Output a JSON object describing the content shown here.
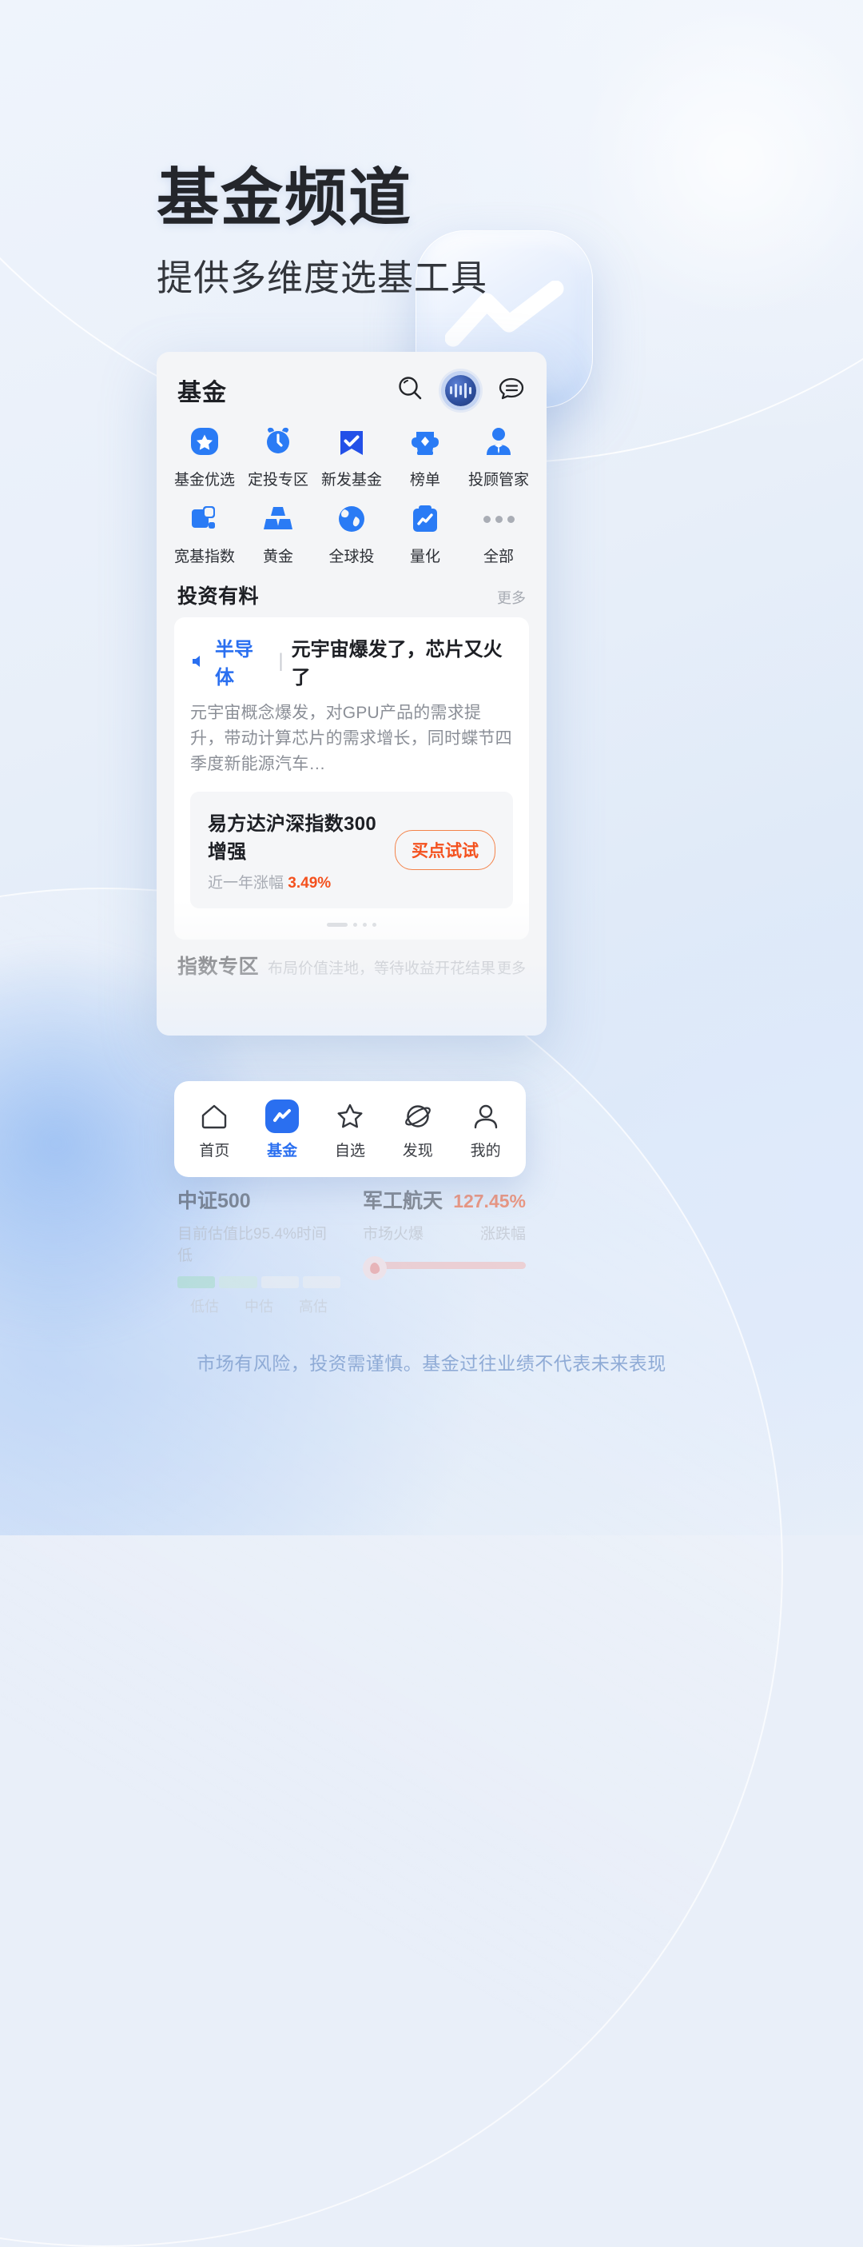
{
  "hero": {
    "headline": "基金频道",
    "subtitle_before": "提供",
    "subtitle_highlight": "多维度",
    "subtitle_after": "选基工具"
  },
  "app": {
    "title": "基金",
    "header_icons": [
      {
        "name": "search-icon",
        "label": "搜索"
      },
      {
        "name": "voice-assistant-icon",
        "label": "语音助手"
      },
      {
        "name": "message-icon",
        "label": "消息"
      }
    ],
    "grid": [
      {
        "label": "基金优选",
        "icon": "star-icon"
      },
      {
        "label": "定投专区",
        "icon": "alarm-clock-icon"
      },
      {
        "label": "新发基金",
        "icon": "bookmark-check-icon"
      },
      {
        "label": "榜单",
        "icon": "trophy-icon"
      },
      {
        "label": "投顾管家",
        "icon": "advisor-person-icon"
      },
      {
        "label": "宽基指数",
        "icon": "squares-icon"
      },
      {
        "label": "黄金",
        "icon": "gold-bars-icon"
      },
      {
        "label": "全球投",
        "icon": "globe-icon"
      },
      {
        "label": "量化",
        "icon": "clipboard-chart-icon"
      },
      {
        "label": "全部",
        "icon": "more-dots-icon"
      }
    ],
    "section_news": {
      "title": "投资有料",
      "more": "更多",
      "tag": "半导体",
      "divider": "|",
      "headline": "元宇宙爆发了，芯片又火了",
      "body": "元宇宙概念爆发，对GPU产品的需求提升，带动计算芯片的需求增长，同时蝶节四季度新能源汽车…",
      "fund_name": "易方达沪深指数300增强",
      "fund_metric_label": "近一年涨幅",
      "fund_metric_value": "3.49%",
      "buy_label": "买点试试"
    },
    "section_index": {
      "title": "指数专区",
      "subtitle": "布局价值洼地，等待收益开花结果",
      "more": "更多"
    },
    "faded_cards": [
      {
        "name": "中证500",
        "desc": "目前估值比95.4%时间低",
        "scale_labels": [
          "低估",
          "中估",
          "高估"
        ]
      },
      {
        "name": "军工航天",
        "percent": "127.45%",
        "desc": "市场火爆",
        "right_label": "涨跌幅"
      }
    ],
    "nav": [
      {
        "label": "首页",
        "icon": "home-icon",
        "active": false
      },
      {
        "label": "基金",
        "icon": "fund-chart-icon",
        "active": true
      },
      {
        "label": "自选",
        "icon": "star-outline-icon",
        "active": false
      },
      {
        "label": "发现",
        "icon": "planet-icon",
        "active": false
      },
      {
        "label": "我的",
        "icon": "person-outline-icon",
        "active": false
      }
    ]
  },
  "disclaimer": "市场有风险，投资需谨慎。基金过往业绩不代表未来表现",
  "colors": {
    "brand_blue": "#2a6ff0",
    "orange": "#f4511e",
    "text_dark": "#1d1f24",
    "text_muted": "#a7abb3"
  }
}
